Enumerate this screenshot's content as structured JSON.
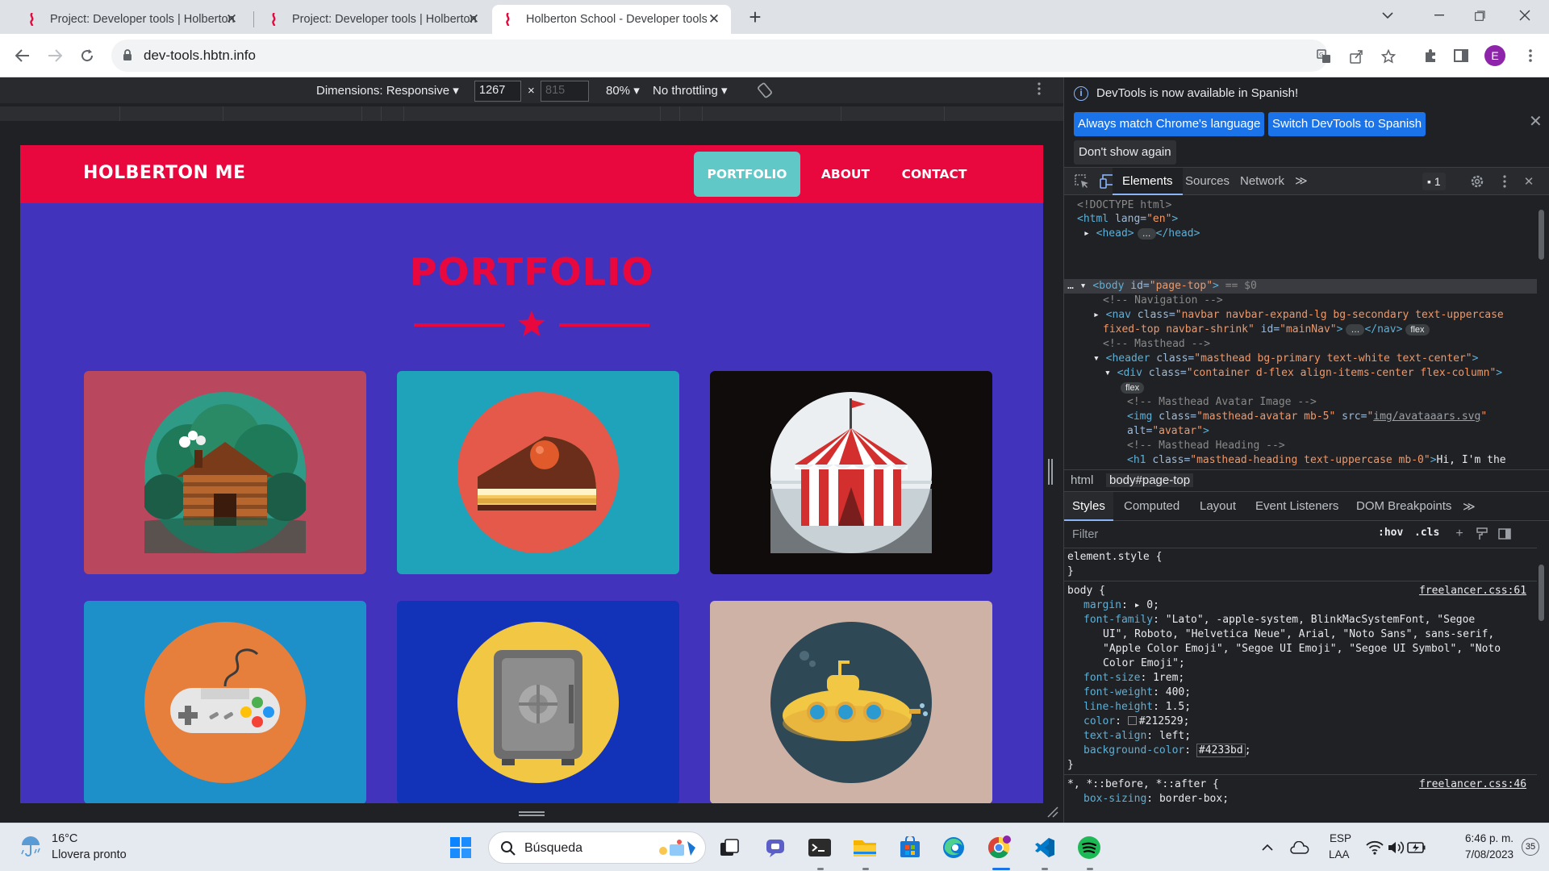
{
  "browser": {
    "tabs": [
      {
        "title": "Project: Developer tools | Holberton",
        "active": false
      },
      {
        "title": "Project: Developer tools | Holberton",
        "active": false
      },
      {
        "title": "Holberton School - Developer tools",
        "active": true
      }
    ],
    "url": "dev-tools.hbtn.info",
    "profile_initial": "E"
  },
  "device_toolbar": {
    "dimensions_label": "Dimensions: Responsive",
    "width": "1267",
    "height_placeholder": "815",
    "times": "×",
    "zoom": "80%",
    "throttling": "No throttling"
  },
  "site": {
    "brand": "HOLBERTON ME",
    "nav": [
      "PORTFOLIO",
      "ABOUT",
      "CONTACT"
    ],
    "section_title": "PORTFOLIO",
    "tiles": [
      {
        "name": "cabin",
        "bg": "#b9485f"
      },
      {
        "name": "cake",
        "bg": "#1fa3bb"
      },
      {
        "name": "circus",
        "bg": "#100c0c"
      },
      {
        "name": "game-controller",
        "bg": "#1d8fc9"
      },
      {
        "name": "safe",
        "bg": "#1232b8"
      },
      {
        "name": "submarine",
        "bg": "#cfb2a6"
      }
    ],
    "colors": {
      "primary": "#e8083e",
      "background": "#4233bd",
      "nav_active": "#61c8c8"
    }
  },
  "devtools": {
    "info_message": "DevTools is now available in Spanish!",
    "btn_match": "Always match Chrome's language",
    "btn_switch": "Switch DevTools to Spanish",
    "btn_dont_show": "Don't show again",
    "tabs": [
      "Elements",
      "Sources",
      "Network"
    ],
    "issues_count": "1",
    "breadcrumbs": [
      "html",
      "body#page-top"
    ],
    "style_tabs": [
      "Styles",
      "Computed",
      "Layout",
      "Event Listeners",
      "DOM Breakpoints"
    ],
    "filter_placeholder": "Filter",
    "hov": ":hov",
    "cls": ".cls",
    "dom": {
      "l1": "<!DOCTYPE html>",
      "html_open": "<html ",
      "html_attr": "lang=",
      "html_val": "\"en\"",
      "html_close": ">",
      "head": "<head>",
      "head_close": "</head>",
      "body_tag": "<body ",
      "body_attr": "id=",
      "body_val": "\"page-top\"",
      "body_end": ">",
      "body_eq": " == $0",
      "c_nav": "<!-- Navigation -->",
      "nav_tag": "<nav ",
      "nav_attr": "class=",
      "nav_val1": "\"navbar navbar-expand-lg bg-secondary text-uppercase",
      "nav_val2": "fixed-top navbar-shrink\"",
      "nav_attr2": " id=",
      "nav_val3": "\"mainNav\"",
      "nav_end": ">",
      "nav_close": "</nav>",
      "flex": "flex",
      "c_masthead": "<!-- Masthead -->",
      "header_tag": "<header ",
      "header_attr": "class=",
      "header_val": "\"masthead bg-primary text-white text-center\"",
      "header_end": ">",
      "div_tag": "<div ",
      "div_attr": "class=",
      "div_val": "\"container d-flex align-items-center flex-column\"",
      "div_end": ">",
      "c_avatar": "<!-- Masthead Avatar Image -->",
      "img_tag": "<img ",
      "img_attr": "class=",
      "img_val": "\"masthead-avatar mb-5\"",
      "img_attr2": " src=",
      "img_src": "img/avataaars.svg",
      "img_alt_attr": "alt=",
      "img_alt_val": "\"avatar\"",
      "img_end": ">",
      "c_heading": "<!-- Masthead Heading -->",
      "h1_tag": "<h1 ",
      "h1_attr": "class=",
      "h1_val": "\"masthead-heading text-uppercase mb-0\"",
      "h1_end": ">",
      "h1_text": "Hi, I'm the"
    },
    "styles": {
      "element_selector": "element.style {",
      "brace_close": "}",
      "body_selector": "body {",
      "body_source": "freelancer.css:61",
      "margin_prop": "margin",
      "margin_val": "0;",
      "ff_prop": "font-family",
      "ff_val1": "\"Lato\", -apple-system, BlinkMacSystemFont, \"Segoe",
      "ff_val2": "UI\", Roboto, \"Helvetica Neue\", Arial, \"Noto Sans\", sans-serif,",
      "ff_val3": "\"Apple Color Emoji\", \"Segoe UI Emoji\", \"Segoe UI Symbol\", \"Noto",
      "ff_val4": "Color Emoji\";",
      "fs_prop": "font-size",
      "fs_val": "1rem;",
      "fw_prop": "font-weight",
      "fw_val": "400;",
      "lh_prop": "line-height",
      "lh_val": "1.5;",
      "color_prop": "color",
      "color_val": "#212529;",
      "ta_prop": "text-align",
      "ta_val": "left;",
      "bg_prop": "background-color",
      "bg_val": "#4233bd",
      "semicolon": ";",
      "universal_selector": "*, *::before, *::after {",
      "universal_source": "freelancer.css:46",
      "bs_prop": "box-sizing",
      "bs_val": "border-box;"
    }
  },
  "taskbar": {
    "temperature": "16°C",
    "forecast": "Llovera pronto",
    "search": "Búsqueda",
    "lang1": "ESP",
    "lang2": "LAA",
    "time": "6:46 p. m.",
    "date": "7/08/2023",
    "notifications": "35"
  }
}
